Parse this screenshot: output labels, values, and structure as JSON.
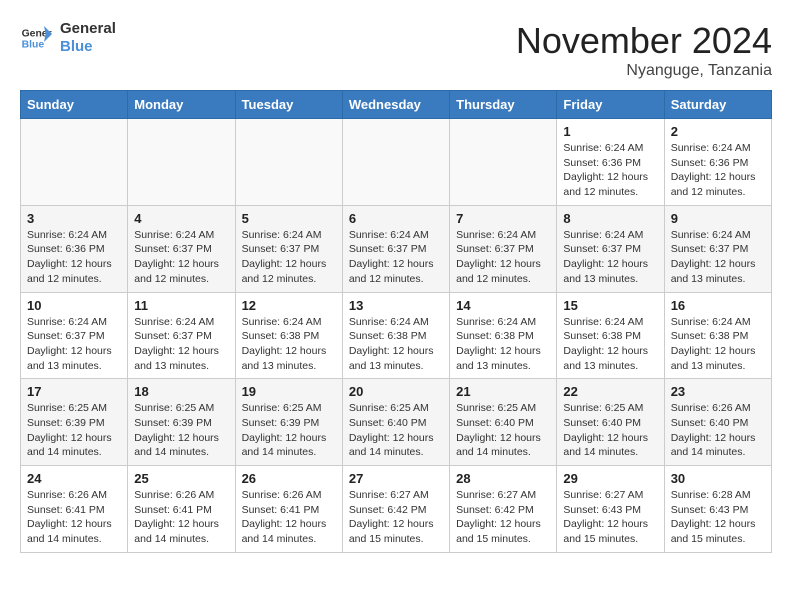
{
  "logo": {
    "line1": "General",
    "line2": "Blue"
  },
  "title": "November 2024",
  "location": "Nyanguge, Tanzania",
  "weekdays": [
    "Sunday",
    "Monday",
    "Tuesday",
    "Wednesday",
    "Thursday",
    "Friday",
    "Saturday"
  ],
  "weeks": [
    [
      {
        "day": "",
        "info": ""
      },
      {
        "day": "",
        "info": ""
      },
      {
        "day": "",
        "info": ""
      },
      {
        "day": "",
        "info": ""
      },
      {
        "day": "",
        "info": ""
      },
      {
        "day": "1",
        "info": "Sunrise: 6:24 AM\nSunset: 6:36 PM\nDaylight: 12 hours\nand 12 minutes."
      },
      {
        "day": "2",
        "info": "Sunrise: 6:24 AM\nSunset: 6:36 PM\nDaylight: 12 hours\nand 12 minutes."
      }
    ],
    [
      {
        "day": "3",
        "info": "Sunrise: 6:24 AM\nSunset: 6:36 PM\nDaylight: 12 hours\nand 12 minutes."
      },
      {
        "day": "4",
        "info": "Sunrise: 6:24 AM\nSunset: 6:37 PM\nDaylight: 12 hours\nand 12 minutes."
      },
      {
        "day": "5",
        "info": "Sunrise: 6:24 AM\nSunset: 6:37 PM\nDaylight: 12 hours\nand 12 minutes."
      },
      {
        "day": "6",
        "info": "Sunrise: 6:24 AM\nSunset: 6:37 PM\nDaylight: 12 hours\nand 12 minutes."
      },
      {
        "day": "7",
        "info": "Sunrise: 6:24 AM\nSunset: 6:37 PM\nDaylight: 12 hours\nand 12 minutes."
      },
      {
        "day": "8",
        "info": "Sunrise: 6:24 AM\nSunset: 6:37 PM\nDaylight: 12 hours\nand 13 minutes."
      },
      {
        "day": "9",
        "info": "Sunrise: 6:24 AM\nSunset: 6:37 PM\nDaylight: 12 hours\nand 13 minutes."
      }
    ],
    [
      {
        "day": "10",
        "info": "Sunrise: 6:24 AM\nSunset: 6:37 PM\nDaylight: 12 hours\nand 13 minutes."
      },
      {
        "day": "11",
        "info": "Sunrise: 6:24 AM\nSunset: 6:37 PM\nDaylight: 12 hours\nand 13 minutes."
      },
      {
        "day": "12",
        "info": "Sunrise: 6:24 AM\nSunset: 6:38 PM\nDaylight: 12 hours\nand 13 minutes."
      },
      {
        "day": "13",
        "info": "Sunrise: 6:24 AM\nSunset: 6:38 PM\nDaylight: 12 hours\nand 13 minutes."
      },
      {
        "day": "14",
        "info": "Sunrise: 6:24 AM\nSunset: 6:38 PM\nDaylight: 12 hours\nand 13 minutes."
      },
      {
        "day": "15",
        "info": "Sunrise: 6:24 AM\nSunset: 6:38 PM\nDaylight: 12 hours\nand 13 minutes."
      },
      {
        "day": "16",
        "info": "Sunrise: 6:24 AM\nSunset: 6:38 PM\nDaylight: 12 hours\nand 13 minutes."
      }
    ],
    [
      {
        "day": "17",
        "info": "Sunrise: 6:25 AM\nSunset: 6:39 PM\nDaylight: 12 hours\nand 14 minutes."
      },
      {
        "day": "18",
        "info": "Sunrise: 6:25 AM\nSunset: 6:39 PM\nDaylight: 12 hours\nand 14 minutes."
      },
      {
        "day": "19",
        "info": "Sunrise: 6:25 AM\nSunset: 6:39 PM\nDaylight: 12 hours\nand 14 minutes."
      },
      {
        "day": "20",
        "info": "Sunrise: 6:25 AM\nSunset: 6:40 PM\nDaylight: 12 hours\nand 14 minutes."
      },
      {
        "day": "21",
        "info": "Sunrise: 6:25 AM\nSunset: 6:40 PM\nDaylight: 12 hours\nand 14 minutes."
      },
      {
        "day": "22",
        "info": "Sunrise: 6:25 AM\nSunset: 6:40 PM\nDaylight: 12 hours\nand 14 minutes."
      },
      {
        "day": "23",
        "info": "Sunrise: 6:26 AM\nSunset: 6:40 PM\nDaylight: 12 hours\nand 14 minutes."
      }
    ],
    [
      {
        "day": "24",
        "info": "Sunrise: 6:26 AM\nSunset: 6:41 PM\nDaylight: 12 hours\nand 14 minutes."
      },
      {
        "day": "25",
        "info": "Sunrise: 6:26 AM\nSunset: 6:41 PM\nDaylight: 12 hours\nand 14 minutes."
      },
      {
        "day": "26",
        "info": "Sunrise: 6:26 AM\nSunset: 6:41 PM\nDaylight: 12 hours\nand 14 minutes."
      },
      {
        "day": "27",
        "info": "Sunrise: 6:27 AM\nSunset: 6:42 PM\nDaylight: 12 hours\nand 15 minutes."
      },
      {
        "day": "28",
        "info": "Sunrise: 6:27 AM\nSunset: 6:42 PM\nDaylight: 12 hours\nand 15 minutes."
      },
      {
        "day": "29",
        "info": "Sunrise: 6:27 AM\nSunset: 6:43 PM\nDaylight: 12 hours\nand 15 minutes."
      },
      {
        "day": "30",
        "info": "Sunrise: 6:28 AM\nSunset: 6:43 PM\nDaylight: 12 hours\nand 15 minutes."
      }
    ]
  ]
}
